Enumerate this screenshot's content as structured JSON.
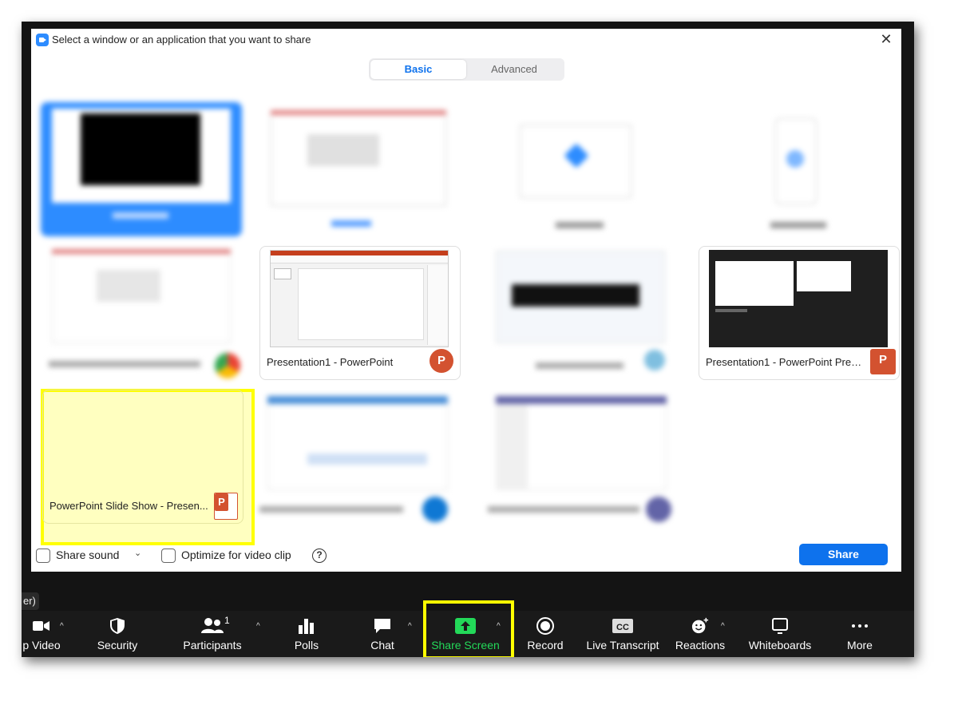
{
  "dialog": {
    "title": "Select a window or an application that you want to share",
    "tabs": [
      {
        "label": "Basic",
        "active": true
      },
      {
        "label": "Advanced",
        "active": false
      }
    ]
  },
  "thumbnails": [
    {
      "label": "Presentation1 - PowerPoint",
      "app": "powerpoint"
    },
    {
      "label": "Presentation1 - PowerPoint Prese...",
      "app": "powerpoint-presenter"
    },
    {
      "label": "PowerPoint Slide Show  -  Presen...",
      "app": "powerpoint-slideshow",
      "highlighted": true
    }
  ],
  "footer": {
    "share_sound": "Share sound",
    "optimize": "Optimize for video clip",
    "help": "?",
    "share_button": "Share"
  },
  "host_badge": "er)",
  "toolbar": {
    "items": [
      {
        "label": "p Video"
      },
      {
        "label": "Security"
      },
      {
        "label": "Participants",
        "count": "1"
      },
      {
        "label": "Polls"
      },
      {
        "label": "Chat"
      },
      {
        "label": "Share Screen"
      },
      {
        "label": "Record"
      },
      {
        "label": "Live Transcript"
      },
      {
        "label": "Reactions"
      },
      {
        "label": "Whiteboards"
      },
      {
        "label": "More"
      }
    ]
  },
  "colors": {
    "accent_blue": "#0e72ed",
    "share_green": "#23d959",
    "highlight_yellow": "#ffff00",
    "powerpoint_orange": "#d35230"
  }
}
